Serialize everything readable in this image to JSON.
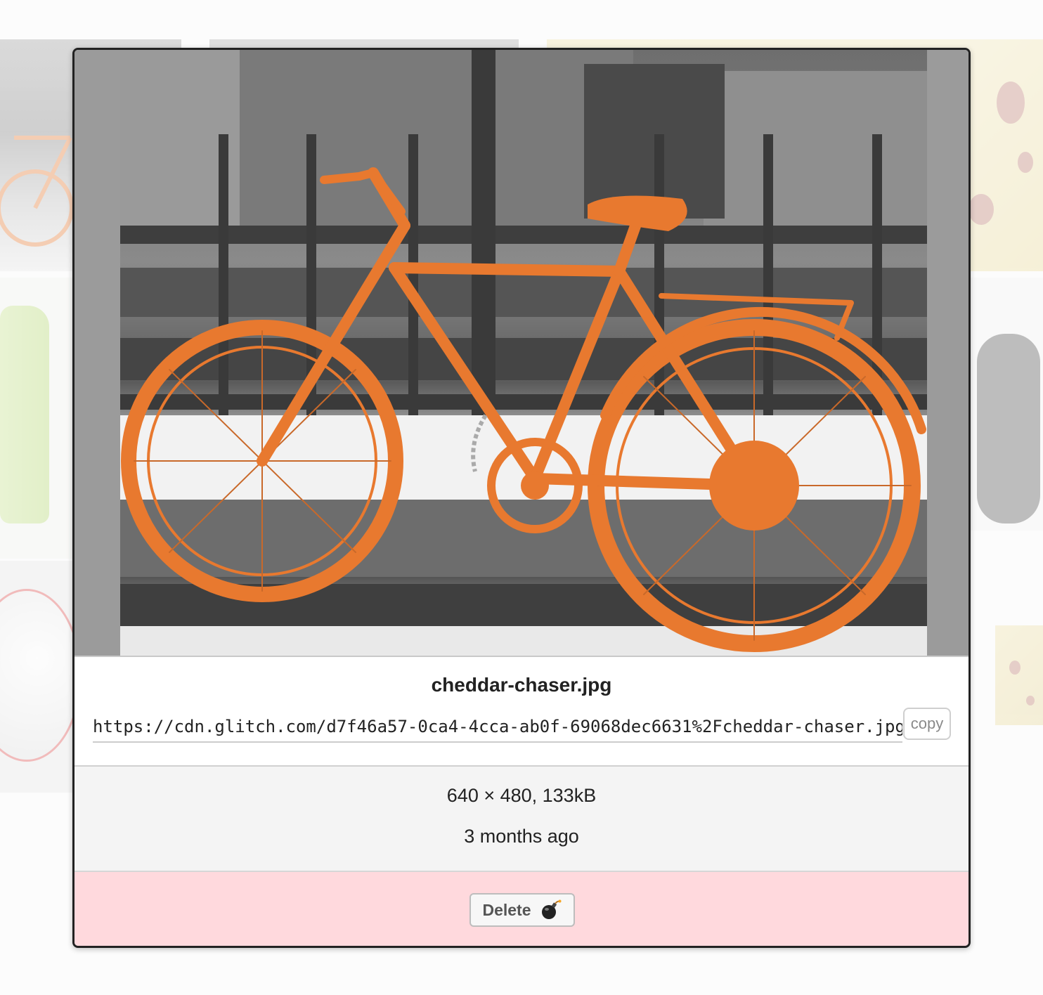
{
  "asset": {
    "filename": "cheddar-chaser.jpg",
    "url": "https://cdn.glitch.com/d7f46a57-0ca4-4cca-ab0f-69068dec6631%2Fcheddar-chaser.jpg",
    "dimensions_size": "640 × 480, 133kB",
    "age": "3 months ago"
  },
  "actions": {
    "copy_label": "copy",
    "delete_label": "Delete"
  },
  "icons": {
    "delete": "bomb-icon"
  },
  "colors": {
    "delete_pane": "#ffd9dd",
    "meta_pane": "#f4f4f4",
    "bike_orange": "#e8792f"
  }
}
